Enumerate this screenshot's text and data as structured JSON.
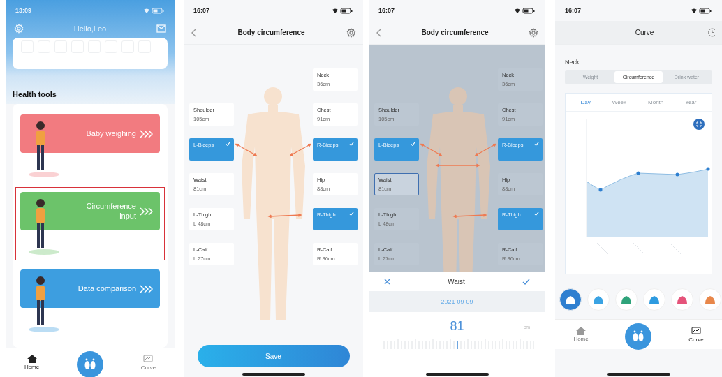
{
  "home": {
    "time": "13:09",
    "greeting": "Hello,Leo",
    "section_title": "Health tools",
    "tools": [
      {
        "label": "Baby weighing",
        "color": "#f27b80",
        "selected": false
      },
      {
        "label": "Circumference input",
        "color": "#6cc36a",
        "selected": true
      },
      {
        "label": "Data comparison",
        "color": "#3d9ee0",
        "selected": false
      }
    ],
    "nav": [
      {
        "label": "Home",
        "selected": true
      },
      {
        "label": "Curve",
        "selected": false
      }
    ]
  },
  "body_circumference": {
    "time": "16:07",
    "title": "Body circumference",
    "left_column": [
      {
        "label": "Shoulder",
        "value": "105cm",
        "checked": false
      },
      {
        "label": "L-Biceps",
        "checked": true
      },
      {
        "label": "Waist",
        "value": "81cm",
        "checked": false
      },
      {
        "label": "L-Thigh",
        "value": "L 48cm",
        "checked": false
      },
      {
        "label": "L-Calf",
        "value": "L 27cm",
        "checked": false
      }
    ],
    "right_column": [
      {
        "label": "Neck",
        "value": "36cm",
        "checked": false
      },
      {
        "label": "Chest",
        "value": "91cm",
        "checked": false
      },
      {
        "label": "R-Biceps",
        "checked": true
      },
      {
        "label": "Hip",
        "value": "88cm",
        "checked": false
      },
      {
        "label": "R-Thigh",
        "checked": true
      },
      {
        "label": "R-Calf",
        "value": "R 36cm",
        "checked": false
      }
    ],
    "save_button": "Save"
  },
  "waist_entry": {
    "time": "16:07",
    "title": "Body circumference",
    "left_column": [
      {
        "label": "Shoulder",
        "value": "105cm",
        "checked": false,
        "selected": false
      },
      {
        "label": "L-Biceps",
        "checked": true,
        "selected": false
      },
      {
        "label": "Waist",
        "value": "81cm",
        "checked": false,
        "selected": true
      },
      {
        "label": "L-Thigh",
        "value": "L 48cm",
        "checked": false,
        "selected": false
      },
      {
        "label": "L-Calf",
        "value": "L 27cm",
        "checked": false,
        "selected": false
      }
    ],
    "right_column": [
      {
        "label": "Neck",
        "value": "36cm",
        "checked": false,
        "selected": false
      },
      {
        "label": "Chest",
        "value": "91cm",
        "checked": false,
        "selected": false
      },
      {
        "label": "R-Biceps",
        "checked": true,
        "selected": false
      },
      {
        "label": "Hip",
        "value": "88cm",
        "checked": false,
        "selected": false
      },
      {
        "label": "R-Thigh",
        "checked": true,
        "selected": false
      },
      {
        "label": "R-Calf",
        "value": "R 36cm",
        "checked": false,
        "selected": false
      }
    ],
    "sheet": {
      "title": "Waist",
      "date": "2021-09-09",
      "value": "81",
      "unit": "cm"
    }
  },
  "curve": {
    "time": "16:07",
    "title": "Curve",
    "part": "Neck",
    "tabs": [
      {
        "label": "Weight",
        "selected": false
      },
      {
        "label": "Circumference",
        "selected": true
      },
      {
        "label": "Drink water",
        "selected": false
      }
    ],
    "periods": [
      {
        "label": "Day",
        "selected": true
      },
      {
        "label": "Week",
        "selected": false
      },
      {
        "label": "Month",
        "selected": false
      },
      {
        "label": "Year",
        "selected": false
      }
    ],
    "body_parts": [
      {
        "color": "#2e7fd0",
        "selected": true
      },
      {
        "color": "#3aa3e3",
        "selected": false
      },
      {
        "color": "#2fa37a",
        "selected": false
      },
      {
        "color": "#2e9be0",
        "selected": false
      },
      {
        "color": "#e5537a",
        "selected": false
      },
      {
        "color": "#e8874a",
        "selected": false
      }
    ],
    "nav": [
      {
        "label": "Home",
        "selected": false
      },
      {
        "label": "Curve",
        "selected": true
      }
    ]
  }
}
